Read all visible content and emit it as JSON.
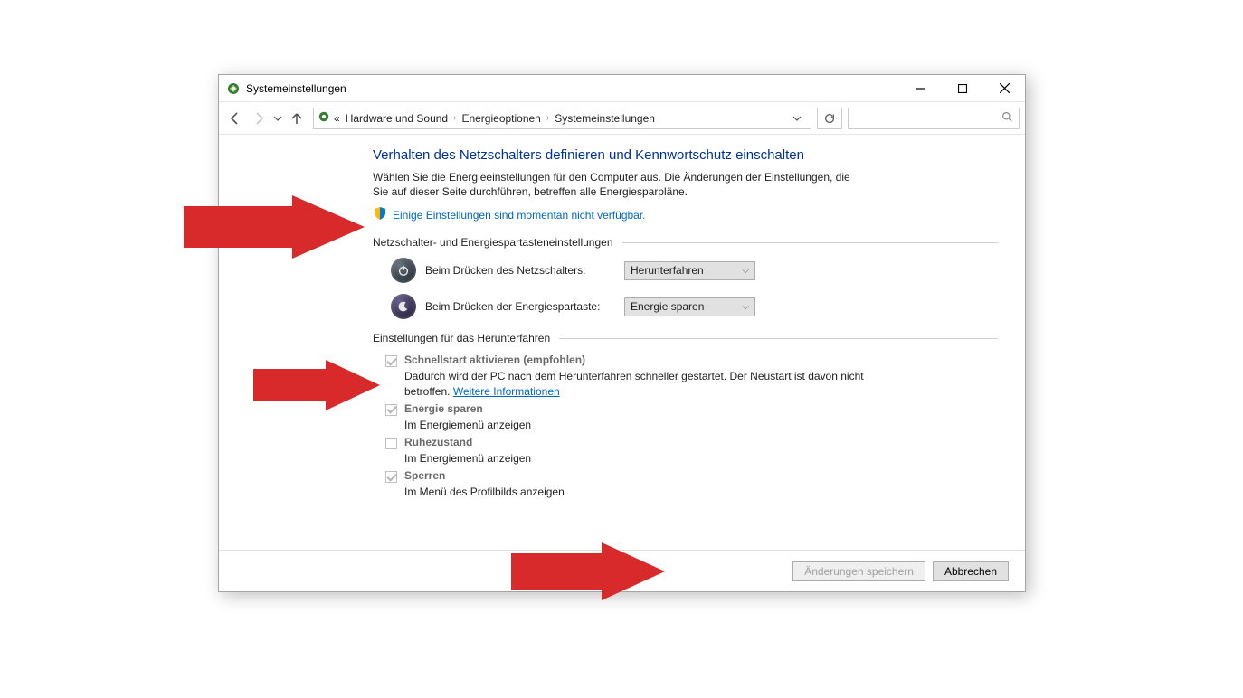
{
  "window": {
    "title": "Systemeinstellungen"
  },
  "breadcrumbs": {
    "prefix": "«",
    "crumb1": "Hardware und Sound",
    "crumb2": "Energieoptionen",
    "crumb3": "Systemeinstellungen"
  },
  "main": {
    "heading": "Verhalten des Netzschalters definieren und Kennwortschutz einschalten",
    "desc": "Wählen Sie die Energieeinstellungen für den Computer aus. Die Änderungen der Einstellungen, die Sie auf dieser Seite durchführen, betreffen alle Energiesparpläne.",
    "shield_link": "Einige Einstellungen sind momentan nicht verfügbar.",
    "section_power": "Netzschalter- und Energiespartasteneinstellungen",
    "power_button_label": "Beim Drücken des Netzschalters:",
    "power_button_value": "Herunterfahren",
    "sleep_button_label": "Beim Drücken der Energiespartaste:",
    "sleep_button_value": "Energie sparen",
    "section_shutdown": "Einstellungen für das Herunterfahren",
    "opts": {
      "faststart": {
        "label": "Schnellstart aktivieren (empfohlen)",
        "desc_a": "Dadurch wird der PC nach dem Herunterfahren schneller gestartet. Der Neustart ist davon nicht betroffen. ",
        "link": "Weitere Informationen"
      },
      "sleep": {
        "label": "Energie sparen",
        "desc": "Im Energiemenü anzeigen"
      },
      "hiber": {
        "label": "Ruhezustand",
        "desc": "Im Energiemenü anzeigen"
      },
      "lock": {
        "label": "Sperren",
        "desc": "Im Menü des Profilbilds anzeigen"
      }
    }
  },
  "buttons": {
    "save": "Änderungen speichern",
    "cancel": "Abbrechen"
  }
}
